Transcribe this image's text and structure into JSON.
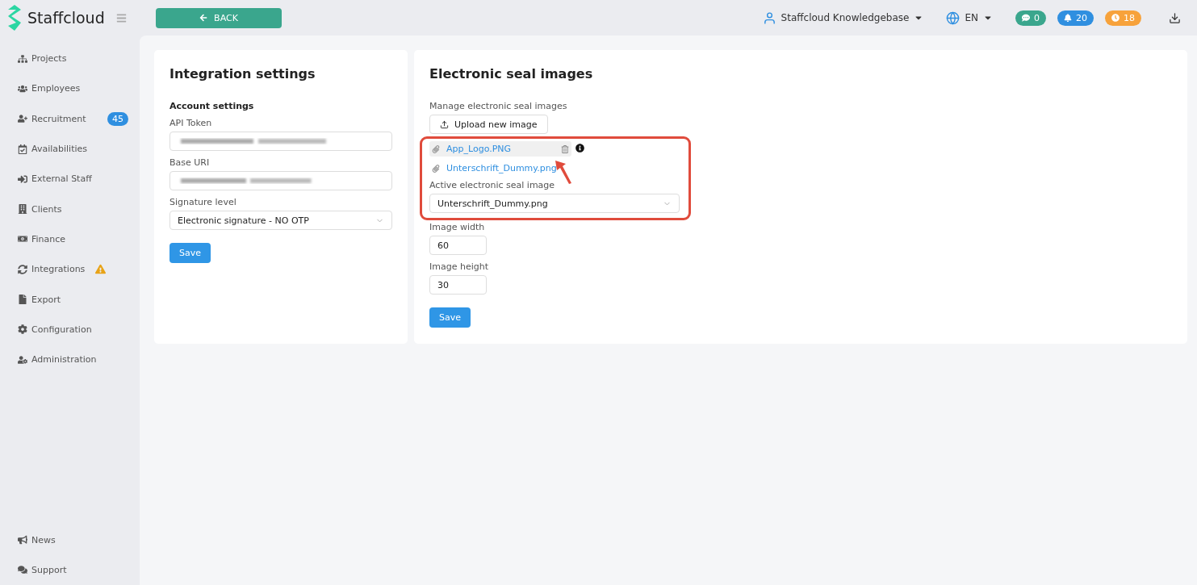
{
  "brand": {
    "name": "Staffcloud"
  },
  "top_bar": {
    "back_button": "BACK",
    "account": "Staffcloud Knowledgebase",
    "language": "EN",
    "counters": [
      {
        "value": "0",
        "color": "#3aa68d"
      },
      {
        "value": "20",
        "color": "#2f8fe0"
      },
      {
        "value": "18",
        "color": "#f7a23b"
      }
    ]
  },
  "sidebar": {
    "items": [
      {
        "label": "Projects"
      },
      {
        "label": "Employees"
      },
      {
        "label": "Recruitment",
        "badge": "45"
      },
      {
        "label": "Availabilities"
      },
      {
        "label": "External Staff"
      },
      {
        "label": "Clients"
      },
      {
        "label": "Finance"
      },
      {
        "label": "Integrations",
        "warning": true
      },
      {
        "label": "Export"
      },
      {
        "label": "Configuration"
      },
      {
        "label": "Administration"
      }
    ],
    "bottom_items": [
      {
        "label": "News"
      },
      {
        "label": "Support"
      }
    ]
  },
  "integration_settings": {
    "title": "Integration settings",
    "section": "Account settings",
    "fields": [
      {
        "label": "API Token",
        "kind": "redacted"
      },
      {
        "label": "Base URI",
        "kind": "redacted"
      },
      {
        "label": "Signature level",
        "kind": "select",
        "value": "Electronic signature - NO OTP"
      }
    ],
    "save": "Save"
  },
  "seal_images": {
    "title": "Electronic seal images",
    "manage_label": "Manage electronic seal images",
    "upload": "Upload new image",
    "files": [
      {
        "name": "App_Logo.PNG",
        "hovered": true
      },
      {
        "name": "Unterschrift_Dummy.png",
        "hovered": false
      }
    ],
    "active_label": "Active electronic seal image",
    "active_value": "Unterschrift_Dummy.png",
    "width_label": "Image width",
    "width_value": "60",
    "height_label": "Image height",
    "height_value": "30",
    "save": "Save"
  }
}
